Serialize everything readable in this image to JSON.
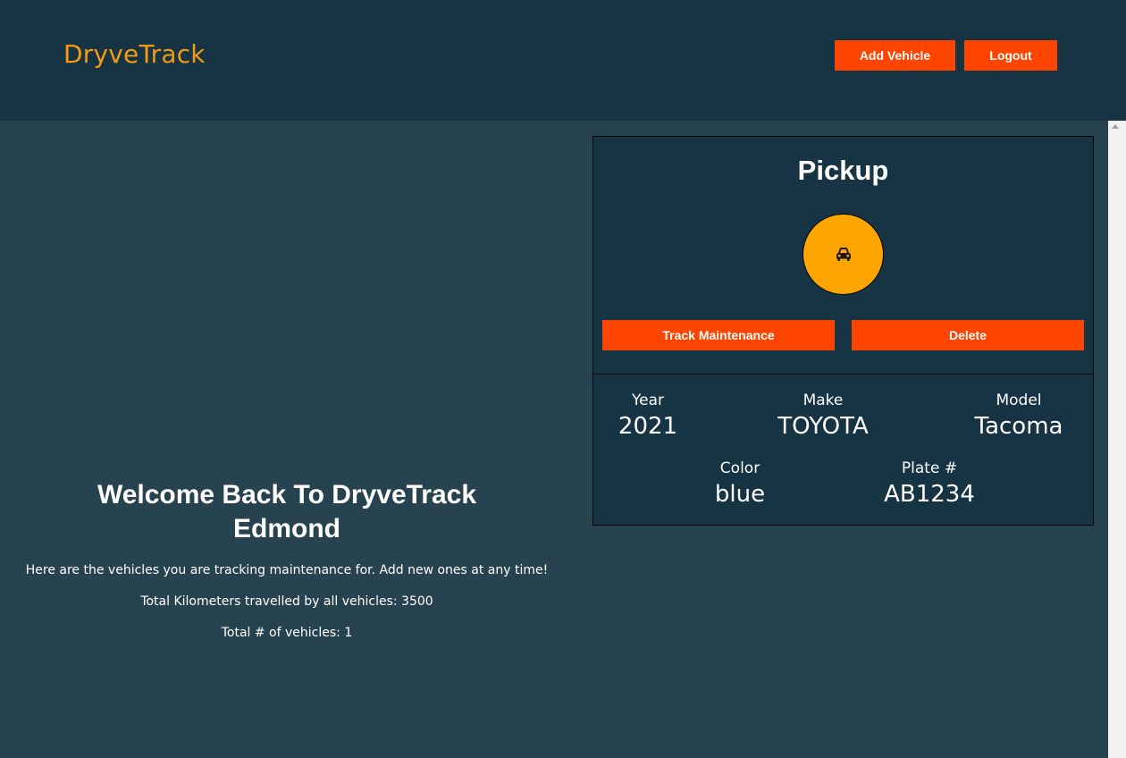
{
  "header": {
    "brand": "DryveTrack",
    "add_vehicle_label": "Add Vehicle",
    "logout_label": "Logout",
    "accent_color": "#f39c12",
    "button_color": "#ff4500"
  },
  "welcome": {
    "title_line1": "Welcome Back To DryveTrack",
    "title_line2": "Edmond",
    "intro": "Here are the vehicles you are tracking maintenance for. Add new ones at any time!",
    "total_km": "Total Kilometers travelled by all vehicles: 3500",
    "total_vehicles": "Total # of vehicles: 1"
  },
  "vehicles": [
    {
      "name": "Pickup",
      "icon": "car-icon",
      "track_label": "Track Maintenance",
      "delete_label": "Delete",
      "year_label": "Year",
      "year": "2021",
      "make_label": "Make",
      "make": "TOYOTA",
      "model_label": "Model",
      "model": "Tacoma",
      "color_label": "Color",
      "color": "blue",
      "plate_label": "Plate #",
      "plate": "AB1234"
    }
  ]
}
